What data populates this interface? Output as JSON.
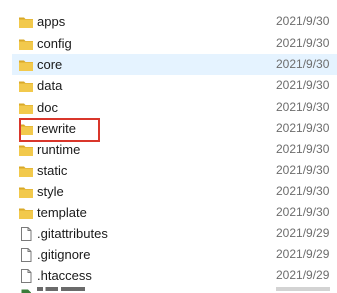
{
  "colors": {
    "folder": "#f2c94c",
    "folder_dark": "#d9a928",
    "selected_row": "#e5f3ff",
    "highlight": "#d9362b",
    "date_text": "#6d6d6d"
  },
  "files": [
    {
      "name": "apps",
      "date": "2021/9/30",
      "icon": "folder-icon"
    },
    {
      "name": "config",
      "date": "2021/9/30",
      "icon": "folder-icon"
    },
    {
      "name": "core",
      "date": "2021/9/30",
      "icon": "folder-icon",
      "selected": true
    },
    {
      "name": "data",
      "date": "2021/9/30",
      "icon": "folder-icon"
    },
    {
      "name": "doc",
      "date": "2021/9/30",
      "icon": "folder-icon"
    },
    {
      "name": "rewrite",
      "date": "2021/9/30",
      "icon": "folder-icon",
      "highlighted": true
    },
    {
      "name": "runtime",
      "date": "2021/9/30",
      "icon": "folder-icon"
    },
    {
      "name": "static",
      "date": "2021/9/30",
      "icon": "folder-icon"
    },
    {
      "name": "style",
      "date": "2021/9/30",
      "icon": "folder-icon"
    },
    {
      "name": "template",
      "date": "2021/9/30",
      "icon": "folder-icon"
    },
    {
      "name": ".gitattributes",
      "date": "2021/9/29",
      "icon": "file-icon"
    },
    {
      "name": ".gitignore",
      "date": "2021/9/29",
      "icon": "file-icon"
    },
    {
      "name": ".htaccess",
      "date": "2021/9/29",
      "icon": "file-icon"
    }
  ]
}
